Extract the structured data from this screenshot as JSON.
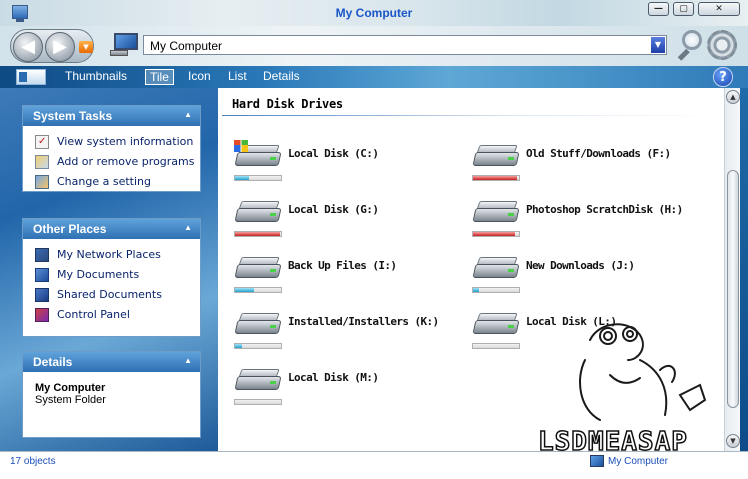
{
  "window": {
    "title": "My Computer"
  },
  "titlebar_buttons": {
    "minimize": "—",
    "maximize": "▢",
    "close": "✕"
  },
  "nav": {
    "back": "◀",
    "forward": "▶",
    "history": "▼"
  },
  "address": {
    "value": "My Computer",
    "dropdown": "▼"
  },
  "toolbar": {
    "views": [
      "Thumbnails",
      "Tile",
      "Icon",
      "List",
      "Details"
    ],
    "active_view": "Tile",
    "help": "?"
  },
  "sidebar": {
    "system_tasks": {
      "title": "System Tasks",
      "collapse": "▲",
      "items": [
        {
          "label": "View system information",
          "icon": "system-info-icon"
        },
        {
          "label": "Add or remove programs",
          "icon": "add-remove-programs-icon"
        },
        {
          "label": "Change a setting",
          "icon": "change-setting-icon"
        }
      ]
    },
    "other_places": {
      "title": "Other Places",
      "collapse": "▲",
      "items": [
        {
          "label": "My Network Places",
          "icon": "network-places-icon"
        },
        {
          "label": "My Documents",
          "icon": "my-documents-icon"
        },
        {
          "label": "Shared Documents",
          "icon": "shared-documents-icon"
        },
        {
          "label": "Control Panel",
          "icon": "control-panel-icon"
        }
      ]
    },
    "details": {
      "title": "Details",
      "collapse": "▲",
      "name": "My Computer",
      "type": "System Folder"
    }
  },
  "content": {
    "group_header": "Hard Disk Drives",
    "drives": [
      {
        "label": "Local Disk (C:)",
        "used_fraction": 0.3,
        "bar_color": "#26a0cc",
        "windows_logo": true
      },
      {
        "label": "Old  Stuff/Downloads (F:)",
        "used_fraction": 0.95,
        "bar_color": "#c82020",
        "windows_logo": false
      },
      {
        "label": "Local Disk (G:)",
        "used_fraction": 0.98,
        "bar_color": "#c82020",
        "windows_logo": false
      },
      {
        "label": "Photoshop ScratchDisk (H:)",
        "used_fraction": 0.92,
        "bar_color": "#c82020",
        "windows_logo": false
      },
      {
        "label": "Back Up Files (I:)",
        "used_fraction": 0.42,
        "bar_color": "#26a0cc",
        "windows_logo": false
      },
      {
        "label": "New Downloads (J:)",
        "used_fraction": 0.12,
        "bar_color": "#26a0cc",
        "windows_logo": false
      },
      {
        "label": "Installed/Installers (K:)",
        "used_fraction": 0.15,
        "bar_color": "#26a0cc",
        "windows_logo": false
      },
      {
        "label": "Local Disk (L:)",
        "used_fraction": 0.0,
        "bar_color": "#26a0cc",
        "windows_logo": false
      },
      {
        "label": "Local Disk (M:)",
        "used_fraction": 0.0,
        "bar_color": "#26a0cc",
        "windows_logo": false
      }
    ]
  },
  "scrollbar": {
    "up": "▲",
    "down": "▼"
  },
  "status": {
    "count": "17 objects",
    "location": "My Computer"
  },
  "watermark": {
    "text": "LSDMEASAP"
  },
  "colors": {
    "link": "#0a246a",
    "status_text": "#1a4fb8",
    "title_text": "#1a56c8",
    "panel_header": "#2f70b4"
  }
}
